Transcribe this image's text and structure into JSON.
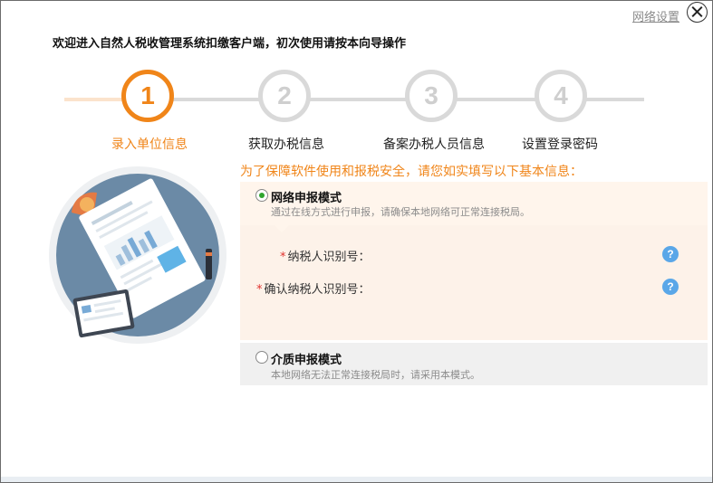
{
  "header": {
    "network_settings_label": "网络设置",
    "welcome_text": "欢迎进入自然人税收管理系统扣缴客户端，初次使用请按本向导操作"
  },
  "steps": [
    {
      "number": "1",
      "label": "录入单位信息",
      "active": true
    },
    {
      "number": "2",
      "label": "获取办税信息",
      "active": false
    },
    {
      "number": "3",
      "label": "备案办税人员信息",
      "active": false
    },
    {
      "number": "4",
      "label": "设置登录密码",
      "active": false
    }
  ],
  "notice": "为了保障软件使用和报税安全，请您如实填写以下基本信息：",
  "network_mode": {
    "title": "网络申报模式",
    "description": "通过在线方式进行申报，请确保本地网络可正常连接税局。",
    "selected": true,
    "fields": [
      {
        "required_mark": "*",
        "label": "纳税人识别号：",
        "value": "",
        "help_icon": "?"
      },
      {
        "required_mark": "*",
        "label": "确认纳税人识别号：",
        "value": "",
        "help_icon": "?"
      }
    ]
  },
  "media_mode": {
    "title": "介质申报模式",
    "description": "本地网络无法正常连接税局时，请采用本模式。",
    "selected": false
  },
  "colors": {
    "accent": "#f08519",
    "inactive_step": "#d9d9d9",
    "radio_selected": "#2ea52e",
    "help_icon": "#5aa7e8",
    "required": "#e0312d"
  }
}
